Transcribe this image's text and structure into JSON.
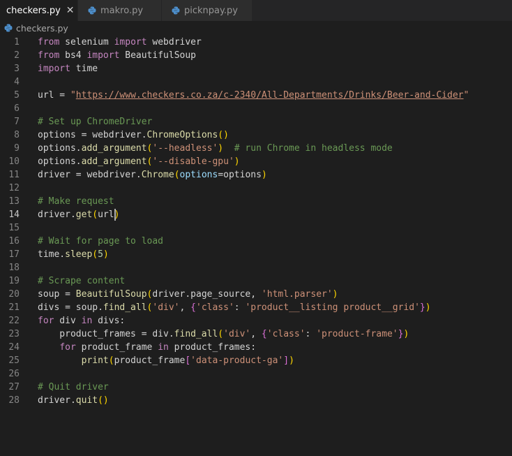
{
  "tabs": [
    {
      "label": "checkers.py",
      "active": true,
      "close": "✕"
    },
    {
      "label": "makro.py",
      "active": false
    },
    {
      "label": "picknpay.py",
      "active": false
    }
  ],
  "breadcrumb": "checkers.py",
  "current_line": 14,
  "colors": {
    "keyword": "#c586c0",
    "string": "#ce9178",
    "comment": "#6a9955",
    "function": "#dcdcaa",
    "param": "#9cdcfe",
    "number": "#b5cea8",
    "bracket1": "#ffd700",
    "bracket2": "#da70d6",
    "text": "#d4d4d4"
  },
  "lines": [
    {
      "n": "1",
      "tokens": [
        [
          "from",
          "kw"
        ],
        [
          " selenium ",
          "t"
        ],
        [
          "import",
          "kw"
        ],
        [
          " webdriver",
          "t"
        ]
      ]
    },
    {
      "n": "2",
      "tokens": [
        [
          "from",
          "kw"
        ],
        [
          " bs4 ",
          "t"
        ],
        [
          "import",
          "kw"
        ],
        [
          " BeautifulSoup",
          "t"
        ]
      ]
    },
    {
      "n": "3",
      "tokens": [
        [
          "import",
          "kw"
        ],
        [
          " time",
          "t"
        ]
      ]
    },
    {
      "n": "4",
      "tokens": []
    },
    {
      "n": "5",
      "tokens": [
        [
          "url = ",
          "t"
        ],
        [
          "\"",
          "str"
        ],
        [
          "https://www.checkers.co.za/c-2340/All-Departments/Drinks/Beer-and-Cider",
          "link"
        ],
        [
          "\"",
          "str"
        ]
      ]
    },
    {
      "n": "6",
      "tokens": []
    },
    {
      "n": "7",
      "tokens": [
        [
          "# Set up ChromeDriver",
          "cm"
        ]
      ]
    },
    {
      "n": "8",
      "tokens": [
        [
          "options = webdriver.",
          "t"
        ],
        [
          "ChromeOptions",
          "fn"
        ],
        [
          "()",
          "b1"
        ]
      ]
    },
    {
      "n": "9",
      "tokens": [
        [
          "options.",
          "t"
        ],
        [
          "add_argument",
          "fn"
        ],
        [
          "(",
          "b1"
        ],
        [
          "'--headless'",
          "str"
        ],
        [
          ")",
          "b1"
        ],
        [
          "  ",
          "t"
        ],
        [
          "# run Chrome in headless mode",
          "cm"
        ]
      ]
    },
    {
      "n": "10",
      "tokens": [
        [
          "options.",
          "t"
        ],
        [
          "add_argument",
          "fn"
        ],
        [
          "(",
          "b1"
        ],
        [
          "'--disable-gpu'",
          "str"
        ],
        [
          ")",
          "b1"
        ]
      ]
    },
    {
      "n": "11",
      "tokens": [
        [
          "driver = webdriver.",
          "t"
        ],
        [
          "Chrome",
          "fn"
        ],
        [
          "(",
          "b1"
        ],
        [
          "options",
          "pa"
        ],
        [
          "=options",
          "t"
        ],
        [
          ")",
          "b1"
        ]
      ]
    },
    {
      "n": "12",
      "tokens": []
    },
    {
      "n": "13",
      "tokens": [
        [
          "# Make request",
          "cm"
        ]
      ]
    },
    {
      "n": "14",
      "tokens": [
        [
          "driver.",
          "t"
        ],
        [
          "get",
          "fn"
        ],
        [
          "(",
          "b1"
        ],
        [
          "url",
          "t"
        ],
        [
          ")",
          "b1"
        ]
      ]
    },
    {
      "n": "15",
      "tokens": []
    },
    {
      "n": "16",
      "tokens": [
        [
          "# Wait for page to load",
          "cm"
        ]
      ]
    },
    {
      "n": "17",
      "tokens": [
        [
          "time.",
          "t"
        ],
        [
          "sleep",
          "fn"
        ],
        [
          "(",
          "b1"
        ],
        [
          "5",
          "num"
        ],
        [
          ")",
          "b1"
        ]
      ]
    },
    {
      "n": "18",
      "tokens": []
    },
    {
      "n": "19",
      "tokens": [
        [
          "# Scrape content",
          "cm"
        ]
      ]
    },
    {
      "n": "20",
      "tokens": [
        [
          "soup = ",
          "t"
        ],
        [
          "BeautifulSoup",
          "fn"
        ],
        [
          "(",
          "b1"
        ],
        [
          "driver.page_source, ",
          "t"
        ],
        [
          "'html.parser'",
          "str"
        ],
        [
          ")",
          "b1"
        ]
      ]
    },
    {
      "n": "21",
      "tokens": [
        [
          "divs = soup.",
          "t"
        ],
        [
          "find_all",
          "fn"
        ],
        [
          "(",
          "b1"
        ],
        [
          "'div'",
          "str"
        ],
        [
          ", ",
          "t"
        ],
        [
          "{",
          "b2"
        ],
        [
          "'class'",
          "str"
        ],
        [
          ": ",
          "t"
        ],
        [
          "'product__listing product__grid'",
          "str"
        ],
        [
          "}",
          "b2"
        ],
        [
          ")",
          "b1"
        ]
      ]
    },
    {
      "n": "22",
      "tokens": [
        [
          "for",
          "kw"
        ],
        [
          " div ",
          "t"
        ],
        [
          "in",
          "kw"
        ],
        [
          " divs:",
          "t"
        ]
      ]
    },
    {
      "n": "23",
      "tokens": [
        [
          "    product_frames = div.",
          "t"
        ],
        [
          "find_all",
          "fn"
        ],
        [
          "(",
          "b1"
        ],
        [
          "'div'",
          "str"
        ],
        [
          ", ",
          "t"
        ],
        [
          "{",
          "b2"
        ],
        [
          "'class'",
          "str"
        ],
        [
          ": ",
          "t"
        ],
        [
          "'product-frame'",
          "str"
        ],
        [
          "}",
          "b2"
        ],
        [
          ")",
          "b1"
        ]
      ]
    },
    {
      "n": "24",
      "tokens": [
        [
          "    ",
          "t"
        ],
        [
          "for",
          "kw"
        ],
        [
          " product_frame ",
          "t"
        ],
        [
          "in",
          "kw"
        ],
        [
          " product_frames:",
          "t"
        ]
      ]
    },
    {
      "n": "25",
      "tokens": [
        [
          "        ",
          "t"
        ],
        [
          "print",
          "fn"
        ],
        [
          "(",
          "b1"
        ],
        [
          "product_frame",
          "t"
        ],
        [
          "[",
          "b2"
        ],
        [
          "'data-product-ga'",
          "str"
        ],
        [
          "]",
          "b2"
        ],
        [
          ")",
          "b1"
        ]
      ]
    },
    {
      "n": "26",
      "tokens": []
    },
    {
      "n": "27",
      "tokens": [
        [
          "# Quit driver",
          "cm"
        ]
      ]
    },
    {
      "n": "28",
      "tokens": [
        [
          "driver.",
          "t"
        ],
        [
          "quit",
          "fn"
        ],
        [
          "()",
          "b1"
        ]
      ]
    }
  ]
}
